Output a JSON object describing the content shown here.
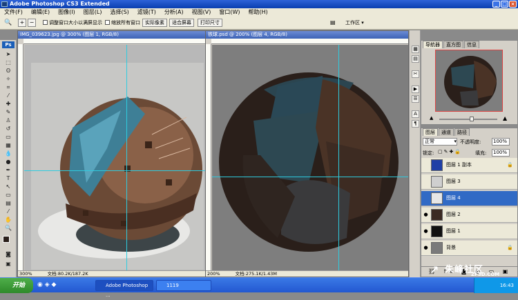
{
  "window": {
    "title": "Adobe Photoshop CS3 Extended"
  },
  "menu": [
    "文件(F)",
    "编辑(E)",
    "图像(I)",
    "图层(L)",
    "选择(S)",
    "滤镜(T)",
    "分析(A)",
    "视图(V)",
    "窗口(W)",
    "帮助(H)"
  ],
  "options": {
    "resize_windows_label": "调整窗口大小以满屏显示",
    "zoom_all_label": "缩放所有窗口",
    "actual_pixels": "实际像素",
    "fit_screen": "适合屏幕",
    "print_size": "打印尺寸",
    "workspace": "工作区 ▾"
  },
  "doc_left": {
    "title": "IMG_039623.jpg @ 300% (图层 1, RGB/8)",
    "zoom": "300%",
    "doc_info": "文档:80.2K/187.2K"
  },
  "doc_right": {
    "title": "铁球.psd @ 200% (图层 4, RGB/8)",
    "zoom": "200%",
    "doc_info": "文档:275.1K/1.43M"
  },
  "navigator": {
    "tabs": [
      "导航器",
      "直方图",
      "信息"
    ]
  },
  "layers": {
    "tabs": [
      "图层",
      "通道",
      "路径"
    ],
    "blend_mode": "正常",
    "opacity_label": "不透明度:",
    "opacity_value": "100%",
    "lock_label": "锁定:",
    "fill_label": "填充:",
    "fill_value": "100%",
    "items": [
      {
        "name": "图层 1 副本",
        "visible": false,
        "locked": true,
        "thumb": "#1f3fa6"
      },
      {
        "name": "图层 3",
        "visible": false,
        "locked": false,
        "thumb": "#cfcfcf"
      },
      {
        "name": "图层 4",
        "visible": false,
        "locked": false,
        "thumb": "#e6e6e6",
        "selected": true
      },
      {
        "name": "图层 2",
        "visible": true,
        "locked": false,
        "thumb": "#3b2a22"
      },
      {
        "name": "图层 1",
        "visible": true,
        "locked": false,
        "thumb": "#111111"
      },
      {
        "name": "背景",
        "visible": true,
        "locked": true,
        "thumb": "#7a7a7a"
      }
    ]
  },
  "taskbar": {
    "start": "开始",
    "items": [
      "Adobe Photoshop ...",
      "1119"
    ],
    "time": "16:43"
  },
  "watermark": {
    "text": "朱峰社区",
    "url": "ZF3D.COM"
  },
  "colors": {
    "accent": "#316ac5",
    "guide": "#2ecce0",
    "canvas": "#7e7e7e"
  }
}
